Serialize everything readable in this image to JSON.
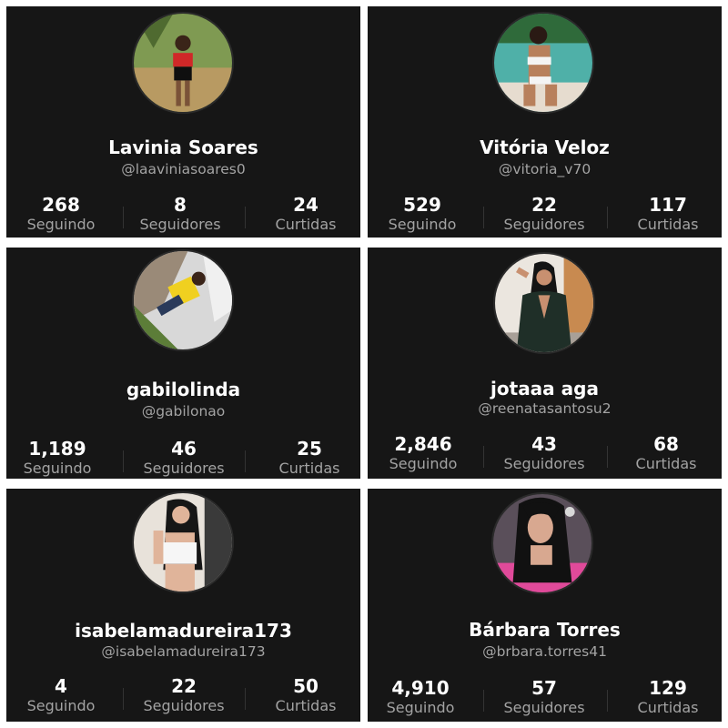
{
  "profiles": [
    {
      "name": "Lavinia Soares",
      "handle": "@laaviniasoares0",
      "stats": [
        {
          "value": "268",
          "label": "Seguindo"
        },
        {
          "value": "8",
          "label": "Seguidores"
        },
        {
          "value": "24",
          "label": "Curtidas"
        }
      ]
    },
    {
      "name": "Vitória Veloz",
      "handle": "@vitoria_v70",
      "stats": [
        {
          "value": "529",
          "label": "Seguindo"
        },
        {
          "value": "22",
          "label": "Seguidores"
        },
        {
          "value": "117",
          "label": "Curtidas"
        }
      ]
    },
    {
      "name": "gabilolinda",
      "handle": "@gabilonao",
      "stats": [
        {
          "value": "1,189",
          "label": "Seguindo"
        },
        {
          "value": "46",
          "label": "Seguidores"
        },
        {
          "value": "25",
          "label": "Curtidas"
        }
      ]
    },
    {
      "name": "jotaaa aga",
      "handle": "@reenatasantosu2",
      "stats": [
        {
          "value": "2,846",
          "label": "Seguindo"
        },
        {
          "value": "43",
          "label": "Seguidores"
        },
        {
          "value": "68",
          "label": "Curtidas"
        }
      ]
    },
    {
      "name": "isabelamadureira173",
      "handle": "@isabelamadureira173",
      "stats": [
        {
          "value": "4",
          "label": "Seguindo"
        },
        {
          "value": "22",
          "label": "Seguidores"
        },
        {
          "value": "50",
          "label": "Curtidas"
        }
      ]
    },
    {
      "name": "Bárbara Torres",
      "handle": "@brbara.torres41",
      "stats": [
        {
          "value": "4,910",
          "label": "Seguindo"
        },
        {
          "value": "57",
          "label": "Seguidores"
        },
        {
          "value": "129",
          "label": "Curtidas"
        }
      ]
    }
  ]
}
